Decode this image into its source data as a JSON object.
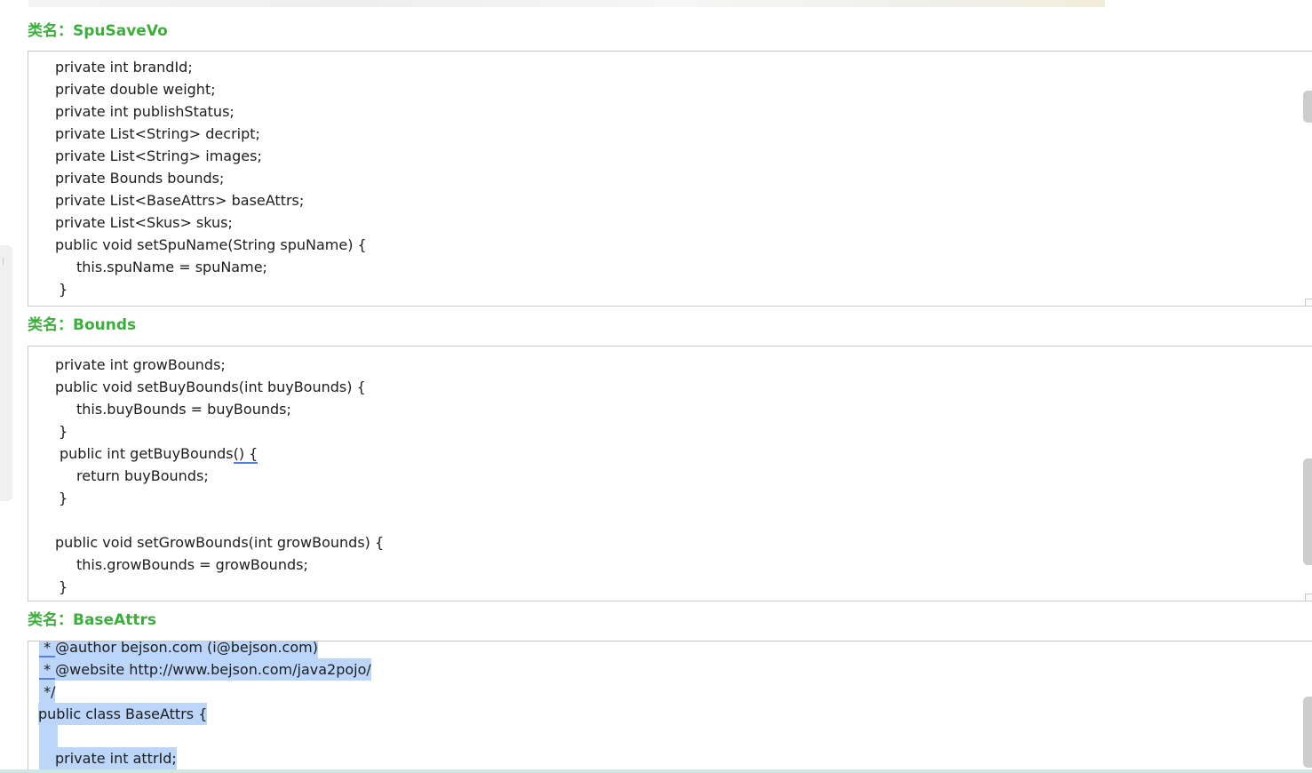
{
  "panels": [
    {
      "label": "类名：SpuSaveVo",
      "lines": [
        {
          "text": "private int brandId;",
          "indent": 30
        },
        {
          "text": "private double weight;",
          "indent": 30
        },
        {
          "text": "private int publishStatus;",
          "indent": 30
        },
        {
          "text": "private List<String> decript;",
          "indent": 30
        },
        {
          "text": "private List<String> images;",
          "indent": 30
        },
        {
          "text": "private Bounds bounds;",
          "indent": 30
        },
        {
          "text": "private List<BaseAttrs> baseAttrs;",
          "indent": 30
        },
        {
          "text": "private List<Skus> skus;",
          "indent": 30
        },
        {
          "text": "public void setSpuName(String spuName) {",
          "indent": 30
        },
        {
          "text": "this.spuName = spuName;",
          "indent": 54
        },
        {
          "text": "}",
          "indent": 34
        }
      ]
    },
    {
      "label": "类名：Bounds",
      "lines": [
        {
          "text": "private int growBounds;",
          "indent": 30
        },
        {
          "text": "public void setBuyBounds(int buyBounds) {",
          "indent": 30
        },
        {
          "text": "this.buyBounds = buyBounds;",
          "indent": 54
        },
        {
          "text": "}",
          "indent": 34
        },
        {
          "text": "public int getBuyBounds",
          "suffix": "() {",
          "indent": 35
        },
        {
          "text": "return buyBounds;",
          "indent": 54
        },
        {
          "text": "}",
          "indent": 34
        },
        {
          "text": "",
          "indent": 30
        },
        {
          "text": "public void setGrowBounds(int growBounds) {",
          "indent": 30
        },
        {
          "text": "this.growBounds = growBounds;",
          "indent": 54
        },
        {
          "text": "}",
          "indent": 34
        }
      ]
    },
    {
      "label": "类名：BaseAttrs",
      "lines": [
        {
          "prefix": " * ",
          "text": "@author bejson.com (i@bejson.com)",
          "indent": 12
        },
        {
          "prefix": " * ",
          "text": "@website http://www.bejson.com/java2pojo/",
          "indent": 12
        },
        {
          "text": " */",
          "indent": 12
        },
        {
          "text": "public class BaseAttrs {",
          "indent": 11
        },
        {
          "text": " ",
          "indent": 12
        },
        {
          "text": "private int attrId;",
          "indent": 30
        }
      ]
    }
  ]
}
